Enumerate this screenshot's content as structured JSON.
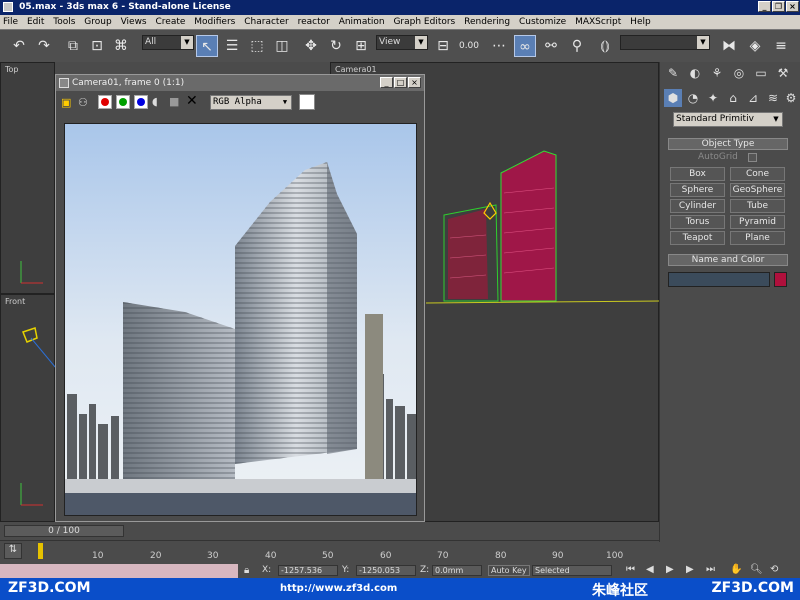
{
  "window": {
    "title": "05.max - 3ds max 6 - Stand-alone License"
  },
  "menu": [
    "File",
    "Edit",
    "Tools",
    "Group",
    "Views",
    "Create",
    "Modifiers",
    "Character",
    "reactor",
    "Animation",
    "Graph Editors",
    "Rendering",
    "Customize",
    "MAXScript",
    "Help"
  ],
  "toolbar": {
    "selection_filter": "All",
    "ref_coord": "View",
    "angle_snap": "0.00"
  },
  "viewports": {
    "top_label": "Top",
    "front_label": "Front",
    "camera_label": "Camera01"
  },
  "render_window": {
    "title": "Camera01, frame 0 (1:1)",
    "channel": "RGB Alpha"
  },
  "command_panel": {
    "category": "Standard Primitiv",
    "object_type_title": "Object Type",
    "autogrid": "AutoGrid",
    "primitives": [
      "Box",
      "Cone",
      "Sphere",
      "GeoSphere",
      "Cylinder",
      "Tube",
      "Torus",
      "Pyramid",
      "Teapot",
      "Plane"
    ],
    "name_color_title": "Name and Color"
  },
  "timeline": {
    "frame_readout": "0 / 100",
    "ticks": [
      "10",
      "20",
      "30",
      "40",
      "50",
      "60",
      "70",
      "80",
      "90",
      "100"
    ]
  },
  "status": {
    "x_label": "X:",
    "x_value": "-1257.536",
    "y_label": "Y:",
    "y_value": "-1250.053",
    "z_label": "Z:",
    "z_value": "0.0mm",
    "autokey": "Auto Key",
    "selected": "Selected"
  },
  "banner": {
    "left": "ZF3D.COM",
    "url": "http://www.zf3d.com",
    "cn": "朱峰社区",
    "right": "ZF3D.COM"
  },
  "colors": {
    "accent_blue": "#0a4ec9",
    "active_button": "#5a7fb5",
    "swatch": "#b0103c"
  }
}
